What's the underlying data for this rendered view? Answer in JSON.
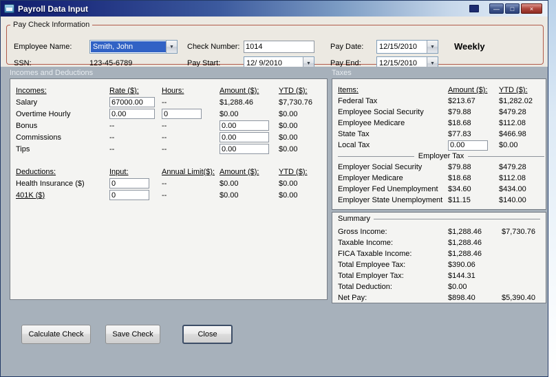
{
  "colors": {
    "titlebar_left": "#111d6b",
    "groupbox_border": "#b05a49",
    "selection_blue": "#3162c5",
    "content_bg": "#a7b1bb",
    "close_button_red": "#b1493f"
  },
  "window": {
    "title": "Payroll Data Input",
    "minimize_glyph": "—",
    "maximize_glyph": "□",
    "close_glyph": "×"
  },
  "paycheck": {
    "legend": "Pay Check Information",
    "employee_name_label": "Employee Name:",
    "employee_name_value": "Smith, John",
    "ssn_label": "SSN:",
    "ssn_value": "123-45-6789",
    "check_number_label": "Check Number:",
    "check_number_value": "1014",
    "pay_start_label": "Pay Start:",
    "pay_start_value": "12/ 9/2010",
    "pay_date_label": "Pay Date:",
    "pay_date_value": "12/15/2010",
    "pay_end_label": "Pay End:",
    "pay_end_value": "12/15/2010",
    "frequency": "Weekly"
  },
  "sections": {
    "incomes_title": "Incomes and Deductions",
    "taxes_title": "Taxes"
  },
  "incomes": {
    "headers": {
      "name": "Incomes:",
      "rate": "Rate ($):",
      "hours": "Hours:",
      "amount": "Amount ($):",
      "ytd": "YTD ($):"
    },
    "rows": [
      {
        "label": "Salary",
        "rate": "67000.00",
        "hours": "--",
        "amount": "$1,288.46",
        "ytd": "$7,730.76"
      },
      {
        "label": "Overtime Hourly",
        "rate": "0.00",
        "hours": "0",
        "amount": "$0.00",
        "ytd": "$0.00"
      },
      {
        "label": "Bonus",
        "rate": "--",
        "hours": "--",
        "amount": "0.00",
        "ytd": "$0.00"
      },
      {
        "label": "Commissions",
        "rate": "--",
        "hours": "--",
        "amount": "0.00",
        "ytd": "$0.00"
      },
      {
        "label": "Tips",
        "rate": "--",
        "hours": "--",
        "amount": "0.00",
        "ytd": "$0.00"
      }
    ]
  },
  "deductions": {
    "headers": {
      "name": "Deductions:",
      "input": "Input:",
      "limit": "Annual Limit($):",
      "amount": "Amount ($):",
      "ytd": "YTD ($):"
    },
    "rows": [
      {
        "label": "Health Insurance ($)",
        "input": "0",
        "limit": "--",
        "amount": "$0.00",
        "ytd": "$0.00"
      },
      {
        "label": "401K ($)",
        "input": "0",
        "limit": "--",
        "amount": "$0.00",
        "ytd": "$0.00"
      }
    ]
  },
  "taxes": {
    "headers": {
      "items": "Items:",
      "amount": "Amount ($):",
      "ytd": "YTD ($):"
    },
    "employee_rows": [
      {
        "label": "Federal Tax",
        "amount": "$213.67",
        "ytd": "$1,282.02"
      },
      {
        "label": "Employee Social Security",
        "amount": "$79.88",
        "ytd": "$479.28"
      },
      {
        "label": "Employee Medicare",
        "amount": "$18.68",
        "ytd": "$112.08"
      },
      {
        "label": "State Tax",
        "amount": "$77.83",
        "ytd": "$466.98"
      },
      {
        "label": "Local Tax",
        "amount": "0.00",
        "ytd": "$0.00"
      }
    ],
    "employer_header": "Employer Tax",
    "employer_rows": [
      {
        "label": "Employer Social Security",
        "amount": "$79.88",
        "ytd": "$479.28"
      },
      {
        "label": "Employer Medicare",
        "amount": "$18.68",
        "ytd": "$112.08"
      },
      {
        "label": "Employer Fed Unemployment",
        "amount": "$34.60",
        "ytd": "$434.00"
      },
      {
        "label": "Employer State Unemployment",
        "amount": "$11.15",
        "ytd": "$140.00"
      }
    ]
  },
  "summary": {
    "title": "Summary",
    "rows": [
      {
        "label": "Gross Income:",
        "amount": "$1,288.46",
        "ytd": "$7,730.76"
      },
      {
        "label": "Taxable Income:",
        "amount": "$1,288.46",
        "ytd": ""
      },
      {
        "label": "FICA Taxable Income:",
        "amount": "$1,288.46",
        "ytd": ""
      },
      {
        "label": "Total Employee Tax:",
        "amount": "$390.06",
        "ytd": ""
      },
      {
        "label": "Total Employer Tax:",
        "amount": "$144.31",
        "ytd": ""
      },
      {
        "label": "Total Deduction:",
        "amount": "$0.00",
        "ytd": ""
      },
      {
        "label": "Net Pay:",
        "amount": "$898.40",
        "ytd": "$5,390.40"
      }
    ]
  },
  "buttons": {
    "calculate": "Calculate Check",
    "save": "Save Check",
    "close": "Close"
  }
}
